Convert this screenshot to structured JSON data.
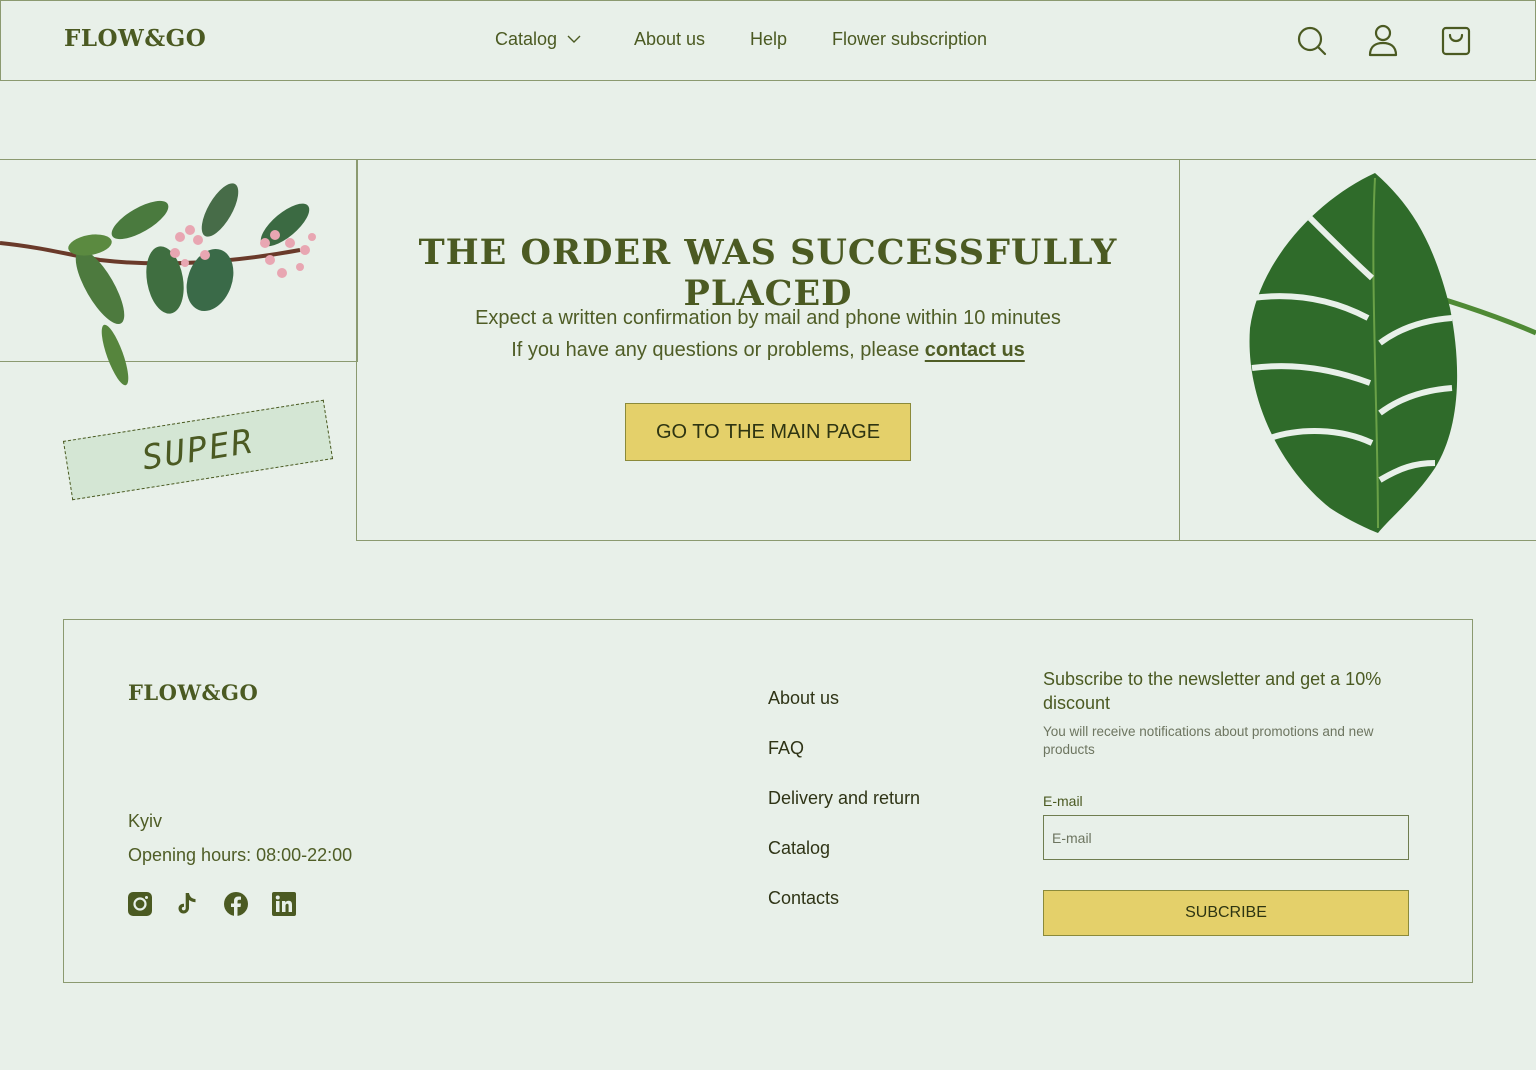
{
  "header": {
    "logo": "FLOW&GO",
    "nav": {
      "catalog": "Catalog",
      "about": "About us",
      "help": "Help",
      "subscription": "Flower subscription"
    },
    "icons": [
      "search-icon",
      "user-icon",
      "cart-icon"
    ]
  },
  "main": {
    "title": "THE ORDER WAS SUCCESSFULLY PLACED",
    "message1": "Expect a written confirmation by mail and phone within 10 minutes",
    "message2_prefix": "If you have any questions or problems, please ",
    "contact_link": "contact us",
    "button": "GO TO THE MAIN PAGE",
    "sticker": "SUPER"
  },
  "footer": {
    "logo": "FLOW&GO",
    "city": "Kyiv",
    "hours": "Opening hours: 08:00-22:00",
    "socials": [
      "instagram-icon",
      "tiktok-icon",
      "facebook-icon",
      "linkedin-icon"
    ],
    "links": [
      "About us",
      "FAQ",
      "Delivery and return",
      "Catalog",
      "Contacts"
    ],
    "newsletter": {
      "title": "Subscribe to the newsletter and get a 10% discount",
      "description": "You will receive notifications about promotions and new products",
      "email_label": "E-mail",
      "email_placeholder": "E-mail",
      "button": "SUBCRIBE"
    }
  },
  "colors": {
    "background": "#e8f0e9",
    "accent": "#e4d06a",
    "text": "#4b5a22",
    "border": "#8b9a70"
  }
}
